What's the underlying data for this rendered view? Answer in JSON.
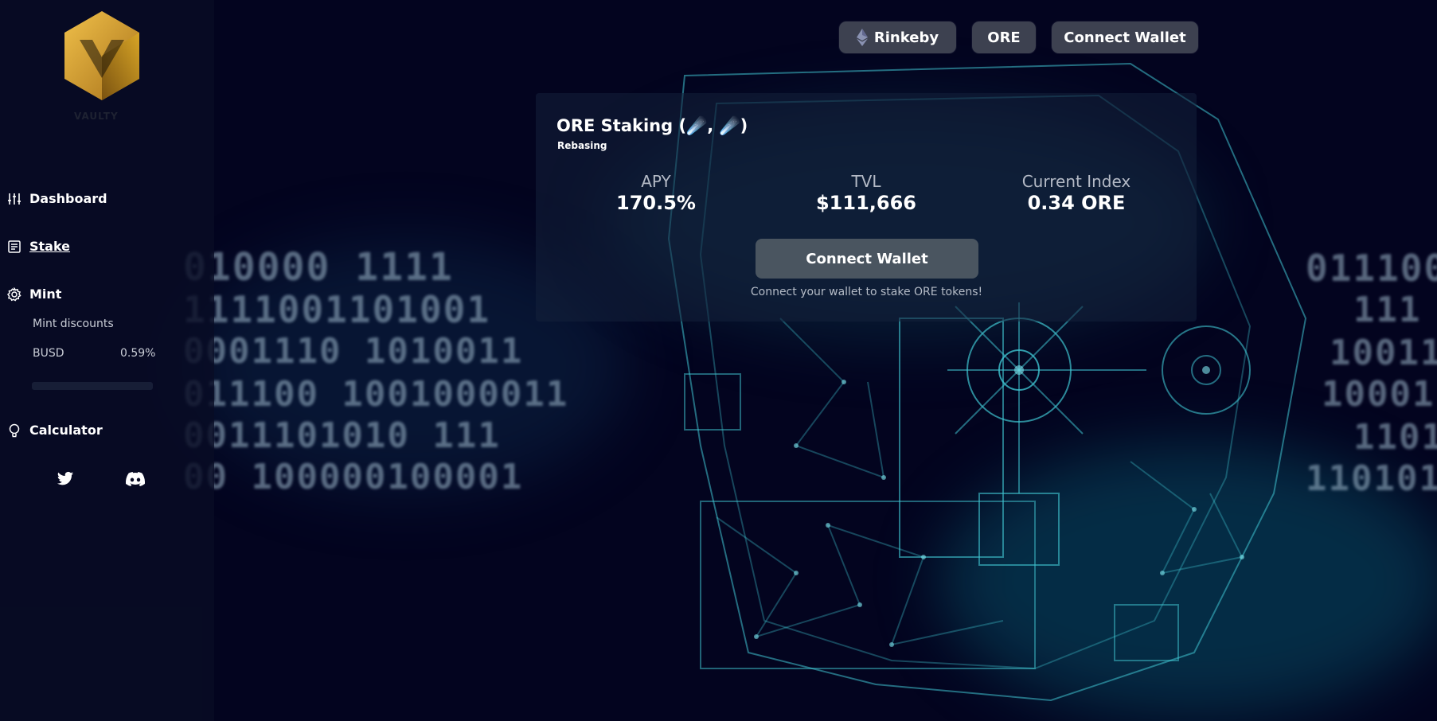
{
  "sidebar": {
    "logo_caption": "VAULTY",
    "nav": [
      {
        "label": "Dashboard",
        "icon": "sliders-icon"
      },
      {
        "label": "Stake",
        "icon": "document-icon"
      },
      {
        "label": "Mint",
        "icon": "gear-icon"
      },
      {
        "label": "Calculator",
        "icon": "bulb-icon"
      }
    ],
    "mint_sub": {
      "heading": "Mint discounts",
      "items": [
        {
          "token": "BUSD",
          "discount": "0.59%"
        }
      ]
    },
    "social": [
      "twitter-icon",
      "discord-icon"
    ]
  },
  "header": {
    "network_label": "Rinkeby",
    "token_label": "ORE",
    "connect_label": "Connect Wallet"
  },
  "staking": {
    "title": "ORE Staking (☄️, ☄️)",
    "subtitle": "Rebasing",
    "metrics": [
      {
        "label": "APY",
        "value": "170.5%"
      },
      {
        "label": "TVL",
        "value": "$111,666"
      },
      {
        "label": "Current Index",
        "value": "0.34 ORE"
      }
    ],
    "button_label": "Connect Wallet",
    "hint": "Connect your wallet to stake ORE tokens!"
  },
  "background": {
    "binary_rows": [
      "010000   1111",
      "1111001101001",
      "0001110 1010011",
      "011100 1001000011",
      "0011101010   111",
      "00     100000100001"
    ],
    "right_binary_rows": [
      "011100",
      "111",
      "10011",
      "10001",
      "1101",
      "110101"
    ]
  },
  "colors": {
    "page_bg": "#03041f",
    "button": "#3d4150",
    "card_button": "#4a5560",
    "logo_gold": "#d8a526",
    "vault_cyan": "#3fc3cf"
  }
}
